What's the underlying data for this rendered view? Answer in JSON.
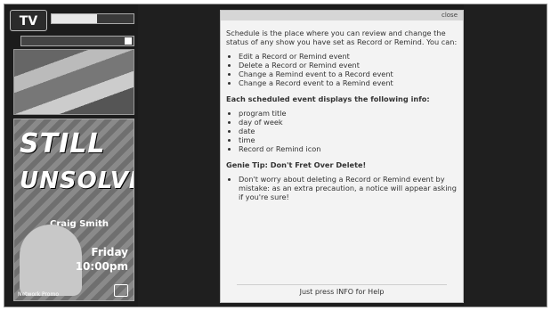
{
  "tv": {
    "logo": "TV",
    "channel_progress": 0.55
  },
  "poster": {
    "line1": "STILL",
    "line2": "UNSOLVED",
    "host": "Craig Smith",
    "day": "Friday",
    "time": "10:00pm",
    "small": "Network Promo"
  },
  "panel": {
    "close_label": "close",
    "intro": "Schedule is the place where you can review and change the status of any show you have set as Record or Remind. You can:",
    "actions": [
      "Edit a Record or Remind event",
      "Delete a Record or Remind event",
      "Change a Remind event to a Record event",
      "Change a Record event to a Remind event"
    ],
    "info_heading": "Each scheduled event displays the following info:",
    "info_items": [
      "program title",
      "day of week",
      "date",
      "time",
      "Record or Remind icon"
    ],
    "tip_heading": "Genie Tip: Don't Fret Over Delete!",
    "tip_text": "Don't worry about deleting a Record or Remind event by mistake: as an extra precaution, a notice will appear asking if you're sure!",
    "footer": "Just press INFO for Help"
  }
}
